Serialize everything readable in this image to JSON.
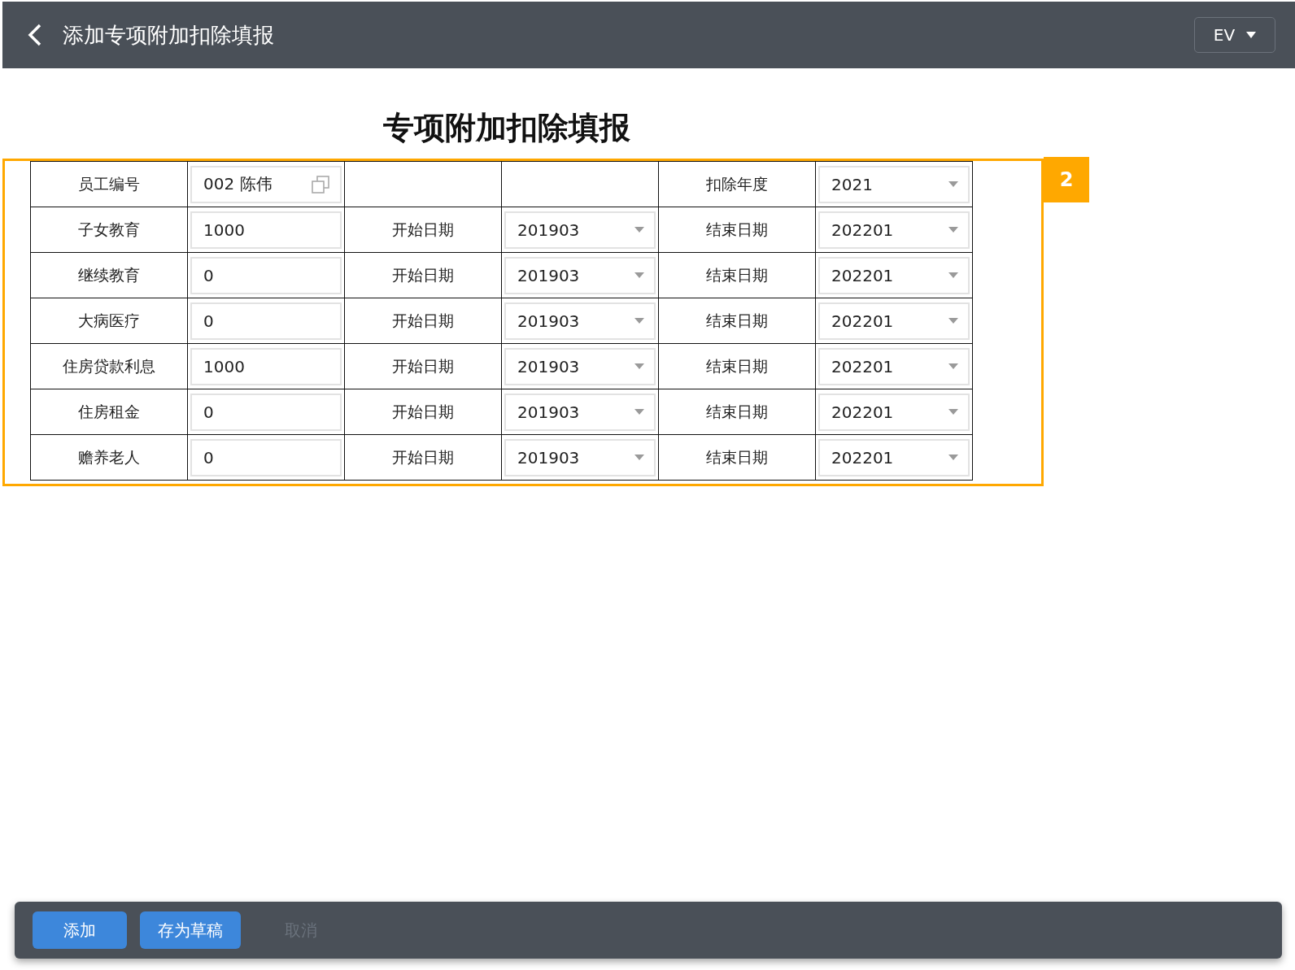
{
  "header": {
    "title": "添加专项附加扣除填报",
    "lang_selector": "EV"
  },
  "form_title": "专项附加扣除填报",
  "callout": {
    "number": "2"
  },
  "employee_row": {
    "label": "员工编号",
    "value": "002 陈伟",
    "year_label": "扣除年度",
    "year": "2021"
  },
  "deductions": [
    {
      "label": "子女教育",
      "amount": "1000",
      "start_label": "开始日期",
      "start": "201903",
      "end_label": "结束日期",
      "end": "202201"
    },
    {
      "label": "继续教育",
      "amount": "0",
      "start_label": "开始日期",
      "start": "201903",
      "end_label": "结束日期",
      "end": "202201"
    },
    {
      "label": "大病医疗",
      "amount": "0",
      "start_label": "开始日期",
      "start": "201903",
      "end_label": "结束日期",
      "end": "202201"
    },
    {
      "label": "住房贷款利息",
      "amount": "1000",
      "start_label": "开始日期",
      "start": "201903",
      "end_label": "结束日期",
      "end": "202201"
    },
    {
      "label": "住房租金",
      "amount": "0",
      "start_label": "开始日期",
      "start": "201903",
      "end_label": "结束日期",
      "end": "202201"
    },
    {
      "label": "赡养老人",
      "amount": "0",
      "start_label": "开始日期",
      "start": "201903",
      "end_label": "结束日期",
      "end": "202201"
    }
  ],
  "footer": {
    "buttons": [
      {
        "label": "添加",
        "disabled": false
      },
      {
        "label": "存为草稿",
        "disabled": false
      },
      {
        "label": "取消",
        "disabled": true
      }
    ]
  }
}
